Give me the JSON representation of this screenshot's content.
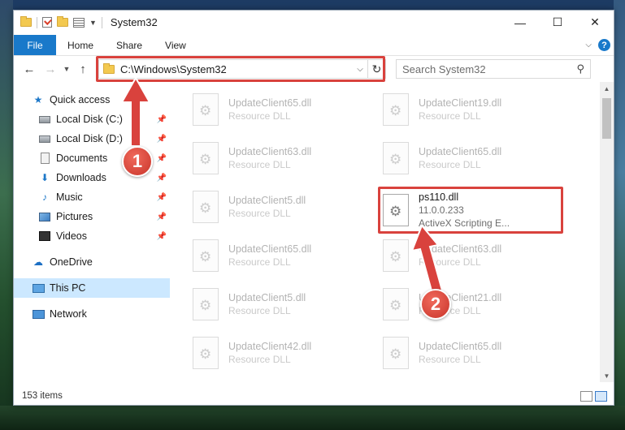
{
  "window": {
    "title": "System32",
    "controls": {
      "minimize": "—",
      "maximize": "☐",
      "close": "✕"
    }
  },
  "ribbon": {
    "file": "File",
    "tabs": [
      "Home",
      "Share",
      "View"
    ]
  },
  "navigation": {
    "address": "C:\\Windows\\System32",
    "search_placeholder": "Search System32"
  },
  "sidebar": {
    "quick_access": "Quick access",
    "pinned": [
      {
        "label": "Local Disk (C:)",
        "icon": "drive-icon"
      },
      {
        "label": "Local Disk (D:)",
        "icon": "drive-icon"
      },
      {
        "label": "Documents",
        "icon": "documents-icon"
      },
      {
        "label": "Downloads",
        "icon": "downloads-icon"
      },
      {
        "label": "Music",
        "icon": "music-icon"
      },
      {
        "label": "Pictures",
        "icon": "pictures-icon"
      },
      {
        "label": "Videos",
        "icon": "videos-icon"
      }
    ],
    "onedrive": "OneDrive",
    "this_pc": "This PC",
    "network": "Network"
  },
  "files": [
    {
      "name": "UpdateClient65.dll",
      "desc": "Resource DLL"
    },
    {
      "name": "UpdateClient19.dll",
      "desc": "Resource DLL"
    },
    {
      "name": "UpdateClient63.dll",
      "desc": "Resource DLL"
    },
    {
      "name": "UpdateClient65.dll",
      "desc": "Resource DLL"
    },
    {
      "name": "UpdateClient5.dll",
      "desc": "Resource DLL"
    },
    {
      "name": "ps110.dll",
      "desc": "11.0.0.233",
      "desc2": "ActiveX Scripting E..."
    },
    {
      "name": "UpdateClient65.dll",
      "desc": "Resource DLL"
    },
    {
      "name": "UpdateClient63.dll",
      "desc": "Resource DLL"
    },
    {
      "name": "UpdateClient5.dll",
      "desc": "Resource DLL"
    },
    {
      "name": "UpdateClient21.dll",
      "desc": "Resource DLL"
    },
    {
      "name": "UpdateClient42.dll",
      "desc": "Resource DLL"
    },
    {
      "name": "UpdateClient65.dll",
      "desc": "Resource DLL"
    }
  ],
  "status": {
    "items": "153 items"
  },
  "annotations": {
    "step1": "1",
    "step2": "2",
    "color": "#d9423d"
  }
}
